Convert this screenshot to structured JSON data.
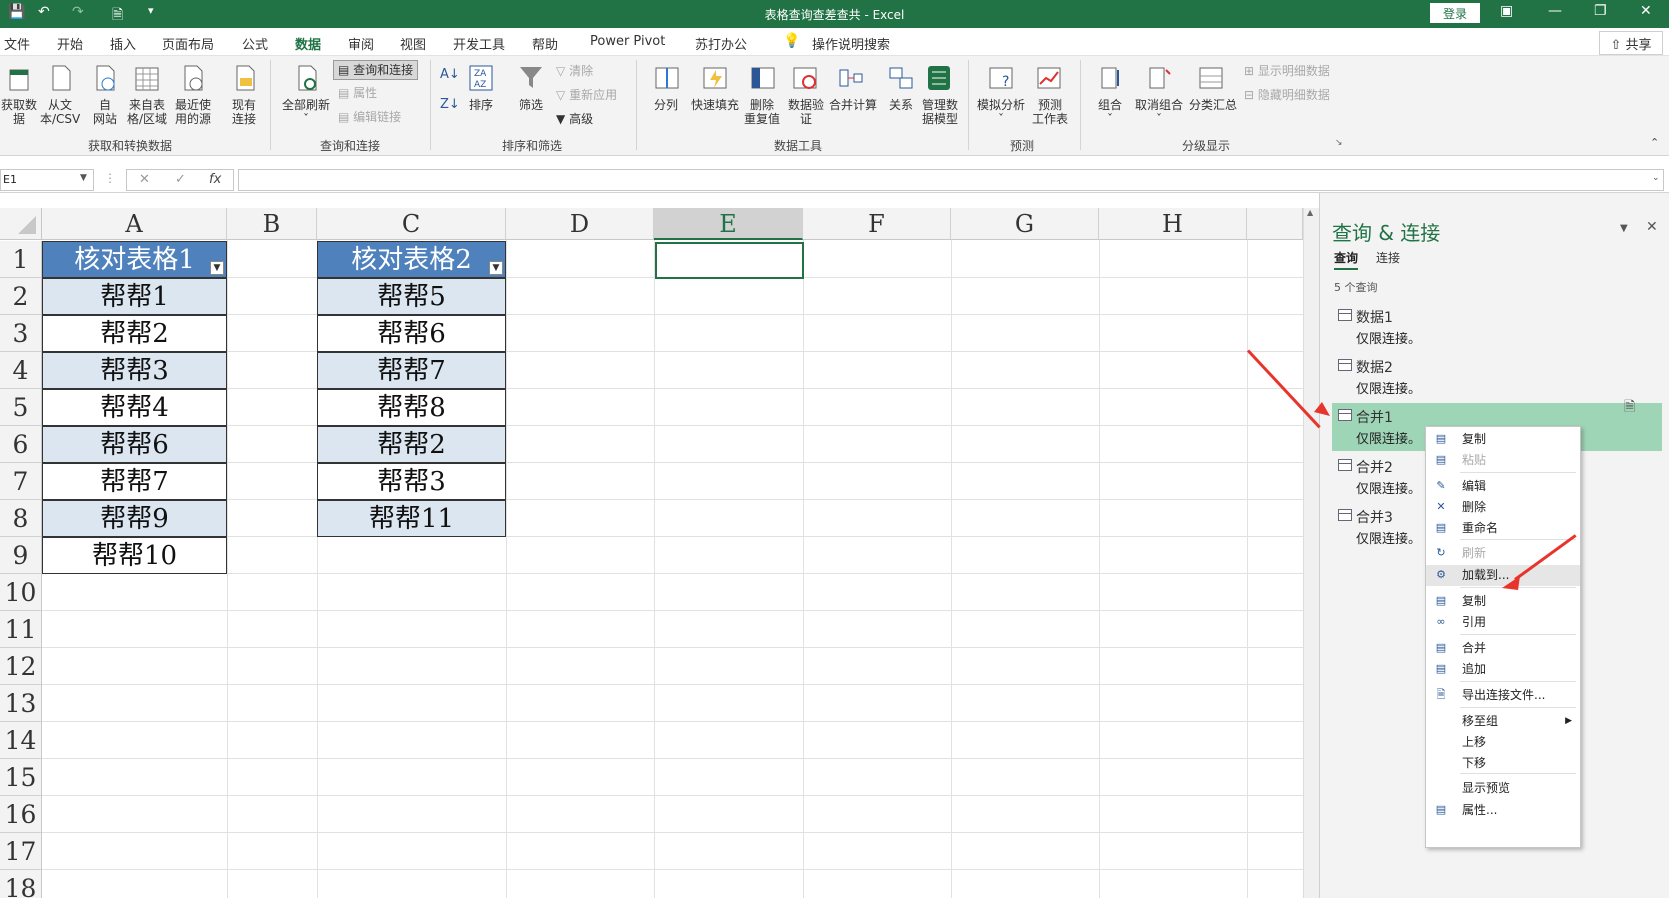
{
  "title": "表格查询查差查共 - Excel",
  "login": "登录",
  "share": "共享",
  "menu": [
    "文件",
    "开始",
    "插入",
    "页面布局",
    "公式",
    "数据",
    "审阅",
    "视图",
    "开发工具",
    "帮助",
    "Power Pivot",
    "苏打办公"
  ],
  "tell_me": "操作说明搜索",
  "ribbon": {
    "get_data": [
      "获取数",
      "据"
    ],
    "from_csv": [
      "从文",
      "本/CSV"
    ],
    "from_web": [
      "自",
      "网站"
    ],
    "from_table": [
      "来自表",
      "格/区域"
    ],
    "recent": [
      "最近使",
      "用的源"
    ],
    "existing": [
      "现有",
      "连接"
    ],
    "refresh_all": [
      "全部刷新"
    ],
    "queries_conn": "查询和连接",
    "properties": "属性",
    "edit_links": "编辑链接",
    "sort": "排序",
    "filter": "筛选",
    "clear": "清除",
    "reapply": "重新应用",
    "advanced": "高级",
    "split": "分列",
    "flash_fill": "快速填充",
    "remove_dup": [
      "删除",
      "重复值"
    ],
    "data_valid": [
      "数据验",
      "证"
    ],
    "consolidate": "合并计算",
    "relations": "关系",
    "data_model": [
      "管理数",
      "据模型"
    ],
    "what_if": "模拟分析",
    "forecast": [
      "预测",
      "工作表"
    ],
    "group": "组合",
    "ungroup": "取消组合",
    "subtotal": "分类汇总",
    "show_detail": "显示明细数据",
    "hide_detail": "隐藏明细数据",
    "groups": [
      "获取和转换数据",
      "查询和连接",
      "排序和筛选",
      "数据工具",
      "预测",
      "分级显示"
    ]
  },
  "namebox": "E1",
  "columns": [
    "A",
    "B",
    "C",
    "D",
    "E",
    "F",
    "G",
    "H"
  ],
  "rows": [
    "1",
    "2",
    "3",
    "4",
    "5",
    "6",
    "7",
    "8",
    "9",
    "10",
    "11",
    "12",
    "13",
    "14",
    "15",
    "16",
    "17",
    "18"
  ],
  "table1": {
    "header": "核对表格1",
    "cells": [
      "帮帮1",
      "帮帮2",
      "帮帮3",
      "帮帮4",
      "帮帮6",
      "帮帮7",
      "帮帮9",
      "帮帮10"
    ]
  },
  "table2": {
    "header": "核对表格2",
    "cells": [
      "帮帮5",
      "帮帮6",
      "帮帮7",
      "帮帮8",
      "帮帮2",
      "帮帮3",
      "帮帮11"
    ]
  },
  "panel": {
    "title": "查询 & 连接",
    "tab_query": "查询",
    "tab_conn": "连接",
    "count": "5 个查询",
    "items": [
      {
        "name": "数据1",
        "sub": "仅限连接。"
      },
      {
        "name": "数据2",
        "sub": "仅限连接。"
      },
      {
        "name": "合并1",
        "sub": "仅限连接。"
      },
      {
        "name": "合并2",
        "sub": "仅限连接。"
      },
      {
        "name": "合并3",
        "sub": "仅限连接。"
      }
    ]
  },
  "context_menu": [
    "复制",
    "粘贴",
    "编辑",
    "删除",
    "重命名",
    "刷新",
    "加载到...",
    "复制",
    "引用",
    "合并",
    "追加",
    "导出连接文件...",
    "移至组",
    "上移",
    "下移",
    "显示预览",
    "属性..."
  ],
  "colors": {
    "excel_green": "#217346",
    "table_header": "#4f81bd",
    "table_band": "#dce6f1",
    "selection": "#9fd5b7",
    "arrow": "#e8352c"
  }
}
